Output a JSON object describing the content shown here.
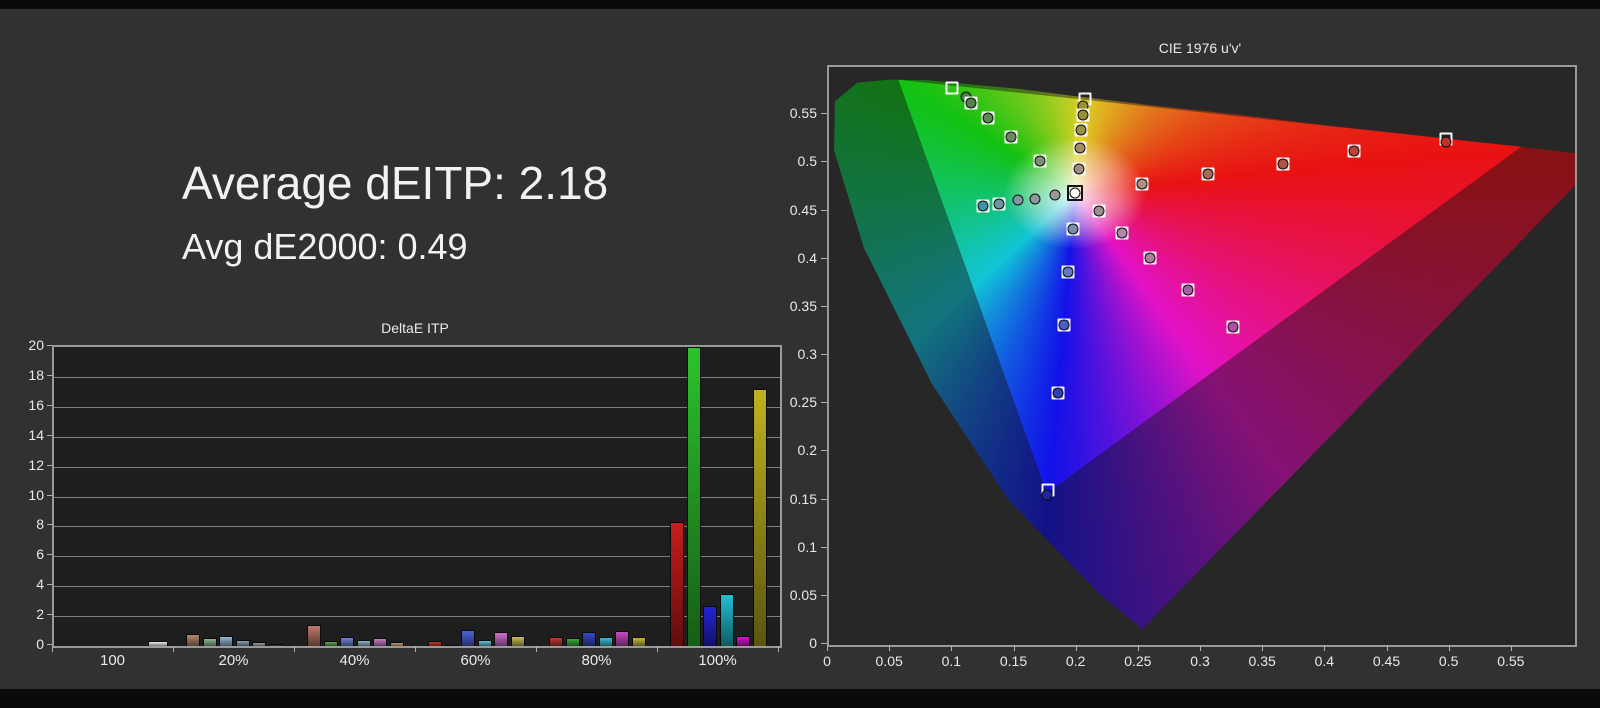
{
  "page": {
    "background": "#313131"
  },
  "summary": {
    "line1": "Average dEITP: 2.18",
    "line2": "Avg dE2000: 0.49"
  },
  "chart_data": [
    {
      "type": "bar",
      "title": "DeltaE ITP",
      "ylabel": "",
      "xlabel": "",
      "ylim": [
        0,
        20
      ],
      "ytick_step": 2,
      "grid": true,
      "categories": [
        "100",
        "20%",
        "40%",
        "60%",
        "80%",
        "100%"
      ],
      "groups": [
        {
          "label": "100",
          "bars": [
            {
              "v": 0.35,
              "c": "#ededed",
              "slot": 5,
              "w": 20,
              "name": "white"
            }
          ]
        },
        {
          "label": "20%",
          "bars": [
            {
              "v": 0.78,
              "c": "#b5886f",
              "name": "red20"
            },
            {
              "v": 0.51,
              "c": "#8db88f",
              "name": "green20"
            },
            {
              "v": 0.65,
              "c": "#93b7d3",
              "name": "blue20"
            },
            {
              "v": 0.42,
              "c": "#89a2b5",
              "name": "cyan20"
            },
            {
              "v": 0.27,
              "c": "#9aa4a8",
              "name": "magenta20"
            },
            {
              "v": 0.11,
              "c": "#3e4649",
              "name": "yellow20"
            }
          ]
        },
        {
          "label": "40%",
          "bars": [
            {
              "v": 1.4,
              "c": "#bd7a6a",
              "name": "red40"
            },
            {
              "v": 0.33,
              "c": "#57a857",
              "name": "green40"
            },
            {
              "v": 0.6,
              "c": "#6d85d4",
              "name": "blue40"
            },
            {
              "v": 0.42,
              "c": "#92b2ca",
              "name": "cyan40"
            },
            {
              "v": 0.55,
              "c": "#cb7bcb",
              "name": "magenta40"
            },
            {
              "v": 0.29,
              "c": "#c59d6e",
              "name": "yellow40"
            }
          ]
        },
        {
          "label": "60%",
          "bars": [
            {
              "v": 0.33,
              "c": "#c0392e",
              "name": "red60"
            },
            {
              "v": 0.04,
              "c": "#3fa83f",
              "name": "green60"
            },
            {
              "v": 1.09,
              "c": "#4f63d8",
              "name": "blue60"
            },
            {
              "v": 0.42,
              "c": "#5fc4d6",
              "name": "cyan60"
            },
            {
              "v": 0.96,
              "c": "#cf70cd",
              "name": "magenta60"
            },
            {
              "v": 0.65,
              "c": "#c9bc55",
              "name": "yellow60"
            }
          ]
        },
        {
          "label": "80%",
          "bars": [
            {
              "v": 0.6,
              "c": "#c43a31",
              "name": "red80"
            },
            {
              "v": 0.53,
              "c": "#3aab3a",
              "name": "green80"
            },
            {
              "v": 0.94,
              "c": "#3747c6",
              "name": "blue80"
            },
            {
              "v": 0.62,
              "c": "#3abfd2",
              "name": "cyan80"
            },
            {
              "v": 0.98,
              "c": "#c74ac0",
              "name": "magenta80"
            },
            {
              "v": 0.62,
              "c": "#c6ba3e",
              "name": "yellow80"
            }
          ]
        },
        {
          "label": "100%",
          "bars": [
            {
              "v": 8.3,
              "c": "#c81d1d",
              "name": "red100"
            },
            {
              "v": 20.0,
              "c": "#2cc42c",
              "name": "green100"
            },
            {
              "v": 2.65,
              "c": "#2424d6",
              "name": "blue100"
            },
            {
              "v": 3.45,
              "c": "#22bfd0",
              "name": "cyan100"
            },
            {
              "v": 0.65,
              "c": "#d414d4",
              "name": "magenta100"
            },
            {
              "v": 17.2,
              "c": "#beb21f",
              "name": "yellow100"
            }
          ]
        }
      ]
    },
    {
      "type": "scatter",
      "title": "CIE 1976 u'v'",
      "xlim": [
        0,
        0.6
      ],
      "ylim": [
        0,
        0.6
      ],
      "grid": false,
      "xticks": [
        "0",
        "0.05",
        "0.1",
        "0.15",
        "0.2",
        "0.25",
        "0.3",
        "0.35",
        "0.4",
        "0.45",
        "0.5",
        "0.55"
      ],
      "yticks": [
        "0",
        "0.05",
        "0.1",
        "0.15",
        "0.2",
        "0.25",
        "0.3",
        "0.35",
        "0.4",
        "0.45",
        "0.5",
        "0.55"
      ],
      "gamut_colors": {
        "red": "#e81212",
        "yellow": "#ddd024",
        "green": "#12c212",
        "cyan": "#12c4d6",
        "blue": "#1212e8",
        "magenta": "#e412c6",
        "dim_overlay": "rgba(18,18,18,0.45)"
      },
      "white_point": {
        "u": 0.198,
        "v": 0.469
      },
      "spectral_locus_uv": [
        [
          0.252,
          0.017
        ],
        [
          0.216,
          0.055
        ],
        [
          0.144,
          0.151
        ],
        [
          0.083,
          0.271
        ],
        [
          0.028,
          0.412
        ],
        [
          0.004,
          0.513
        ],
        [
          0.005,
          0.564
        ],
        [
          0.023,
          0.584
        ],
        [
          0.05,
          0.587
        ],
        [
          0.079,
          0.586
        ],
        [
          0.113,
          0.582
        ],
        [
          0.153,
          0.577
        ],
        [
          0.203,
          0.569
        ],
        [
          0.262,
          0.56
        ],
        [
          0.332,
          0.55
        ],
        [
          0.404,
          0.539
        ],
        [
          0.469,
          0.53
        ],
        [
          0.52,
          0.522
        ],
        [
          0.583,
          0.513
        ],
        [
          0.623,
          0.507
        ]
      ],
      "gamut_triangle_uv": [
        [
          0.056,
          0.587
        ],
        [
          0.175,
          0.158
        ],
        [
          0.557,
          0.517
        ]
      ],
      "markers": [
        {
          "u": 0.099,
          "v": 0.578,
          "sq": "white",
          "circle": false,
          "fill": null
        },
        {
          "u": 0.11,
          "v": 0.569,
          "sq": null,
          "circle": true,
          "fill": "#4e7c45"
        },
        {
          "u": 0.114,
          "v": 0.563,
          "sq": "white",
          "circle": true,
          "fill": "#558049"
        },
        {
          "u": 0.128,
          "v": 0.547,
          "sq": "white",
          "circle": true,
          "fill": "#5d8753"
        },
        {
          "u": 0.146,
          "v": 0.527,
          "sq": "white",
          "circle": true,
          "fill": "#6b8a60"
        },
        {
          "u": 0.17,
          "v": 0.502,
          "sq": "white",
          "circle": true,
          "fill": "#7b9173"
        },
        {
          "u": 0.206,
          "v": 0.567,
          "sq": "white",
          "circle": false,
          "fill": null
        },
        {
          "u": 0.204,
          "v": 0.56,
          "sq": null,
          "circle": true,
          "fill": "#9b9331"
        },
        {
          "u": 0.204,
          "v": 0.55,
          "sq": "white",
          "circle": true,
          "fill": "#96902e"
        },
        {
          "u": 0.203,
          "v": 0.535,
          "sq": "white",
          "circle": true,
          "fill": "#9a9048"
        },
        {
          "u": 0.202,
          "v": 0.516,
          "sq": "white",
          "circle": true,
          "fill": "#a19067"
        },
        {
          "u": 0.201,
          "v": 0.494,
          "sq": "white",
          "circle": true,
          "fill": "#a08f7c"
        },
        {
          "u": 0.198,
          "v": 0.469,
          "sq": "black",
          "circle": true,
          "fill": "#ffffff"
        },
        {
          "u": 0.182,
          "v": 0.467,
          "sq": null,
          "circle": true,
          "fill": "#98999a"
        },
        {
          "u": 0.166,
          "v": 0.463,
          "sq": null,
          "circle": true,
          "fill": "#8b9aa2"
        },
        {
          "u": 0.152,
          "v": 0.462,
          "sq": null,
          "circle": true,
          "fill": "#7d99a2"
        },
        {
          "u": 0.137,
          "v": 0.458,
          "sq": "white",
          "circle": true,
          "fill": "#6b97a5"
        },
        {
          "u": 0.124,
          "v": 0.456,
          "sq": "white",
          "circle": true,
          "fill": "#3e95a8"
        },
        {
          "u": 0.217,
          "v": 0.451,
          "sq": "white",
          "circle": true,
          "fill": "#9b8e95"
        },
        {
          "u": 0.196,
          "v": 0.432,
          "sq": "white",
          "circle": true,
          "fill": "#7d8eae"
        },
        {
          "u": 0.236,
          "v": 0.428,
          "sq": "white",
          "circle": true,
          "fill": "#b186ad"
        },
        {
          "u": 0.252,
          "v": 0.479,
          "sq": "white",
          "circle": true,
          "fill": "#ae8e88"
        },
        {
          "u": 0.192,
          "v": 0.387,
          "sq": "white",
          "circle": true,
          "fill": "#6279bf"
        },
        {
          "u": 0.189,
          "v": 0.332,
          "sq": "white",
          "circle": true,
          "fill": "#4a5ec7"
        },
        {
          "u": 0.184,
          "v": 0.262,
          "sq": "white",
          "circle": true,
          "fill": "#2e3eb6"
        },
        {
          "u": 0.176,
          "v": 0.161,
          "sq": "white",
          "circle": false,
          "fill": null
        },
        {
          "u": 0.175,
          "v": 0.156,
          "sq": null,
          "circle": true,
          "fill": "#2227a0"
        },
        {
          "u": 0.305,
          "v": 0.489,
          "sq": "white",
          "circle": true,
          "fill": "#a46a54"
        },
        {
          "u": 0.365,
          "v": 0.499,
          "sq": "white",
          "circle": true,
          "fill": "#af5445"
        },
        {
          "u": 0.422,
          "v": 0.513,
          "sq": "white",
          "circle": true,
          "fill": "#bb4437"
        },
        {
          "u": 0.496,
          "v": 0.525,
          "sq": "white",
          "circle": false,
          "fill": null
        },
        {
          "u": 0.496,
          "v": 0.522,
          "sq": null,
          "circle": true,
          "fill": "#bf3028"
        },
        {
          "u": 0.258,
          "v": 0.402,
          "sq": "white",
          "circle": true,
          "fill": "#af7e9d"
        },
        {
          "u": 0.289,
          "v": 0.368,
          "sq": "white",
          "circle": true,
          "fill": "#a75ea7"
        },
        {
          "u": 0.325,
          "v": 0.33,
          "sq": "white",
          "circle": true,
          "fill": "#af50a7"
        }
      ]
    }
  ]
}
